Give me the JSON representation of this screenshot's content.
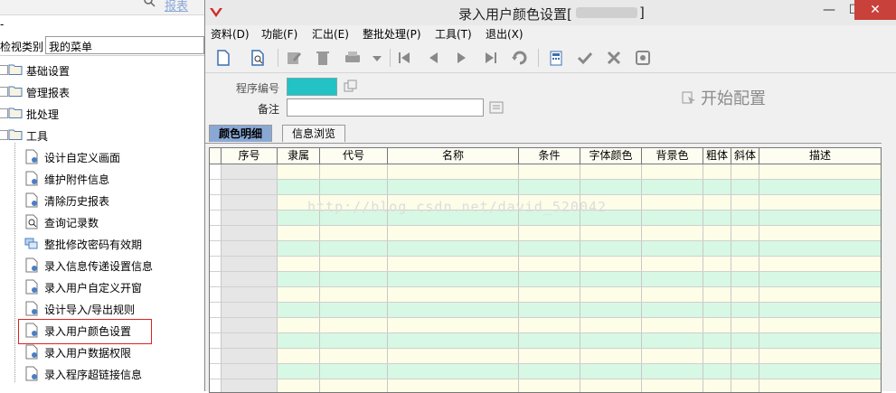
{
  "left_panel": {
    "top_faded_text": "报表",
    "dash": "-",
    "view_category_label": "检视类别",
    "view_category_value": "我的菜单",
    "folders": [
      "基础设置",
      "管理报表",
      "批处理",
      "工具"
    ],
    "tools_items": [
      {
        "label": "设计自定义画面",
        "icon": "doc-gear-icon"
      },
      {
        "label": "维护附件信息",
        "icon": "doc-gear-icon"
      },
      {
        "label": "清除历史报表",
        "icon": "doc-gear-icon"
      },
      {
        "label": "查询记录数",
        "icon": "doc-magnifier-icon"
      },
      {
        "label": "整批修改密码有效期",
        "icon": "windows-icon"
      },
      {
        "label": "录入信息传递设置信息",
        "icon": "doc-gear-icon"
      },
      {
        "label": "录入用户自定义开窗",
        "icon": "doc-gear-icon"
      },
      {
        "label": "设计导入/导出规则",
        "icon": "doc-gear-icon"
      },
      {
        "label": "录入用户颜色设置",
        "icon": "doc-gear-icon",
        "highlighted": true
      },
      {
        "label": "录入用户数据权限",
        "icon": "doc-gear-icon"
      },
      {
        "label": "录入程序超链接信息",
        "icon": "doc-gear-icon"
      }
    ]
  },
  "window": {
    "title": "录入用户颜色设置[",
    "title_suffix": "]",
    "controls": {
      "minimize": "—",
      "maximize": "☐",
      "close": "✕"
    },
    "menu": [
      "资料(D)",
      "功能(F)",
      "汇出(E)",
      "整批处理(P)",
      "工具(T)",
      "退出(X)"
    ],
    "toolbar_icons": [
      "new-icon",
      "query-icon",
      "edit-icon",
      "delete-icon",
      "print-icon",
      "dropdown-icon",
      "first-icon",
      "prev-icon",
      "next-icon",
      "last-icon",
      "refresh-icon",
      "calculator-icon",
      "confirm-icon",
      "cancel-icon",
      "attachment-icon"
    ],
    "form": {
      "program_no_label": "程序编号",
      "note_label": "备注",
      "start_config": "开始配置",
      "accent_color": "#22c2c5"
    },
    "tabs": [
      "颜色明细",
      "信息浏览"
    ],
    "grid": {
      "columns": [
        "序号",
        "隶属",
        "代号",
        "名称",
        "条件",
        "字体颜色",
        "背景色",
        "粗体",
        "斜体",
        "描述"
      ],
      "row_colors": [
        "#fdfde8",
        "#d7f8e4"
      ]
    },
    "watermark": "http://blog.csdn.net/david_520042"
  }
}
